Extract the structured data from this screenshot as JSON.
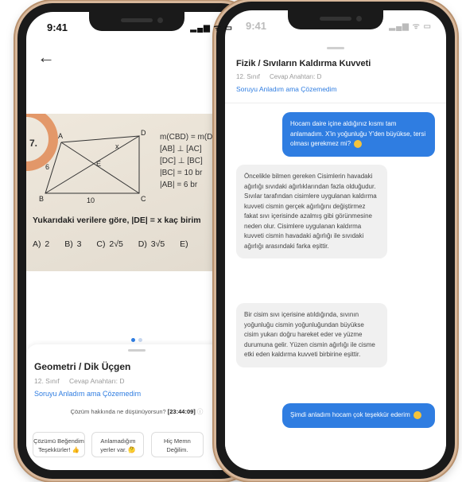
{
  "left_phone": {
    "status_time": "9:41",
    "status_icons": "▂▄▆ ᯤ ▭",
    "question_number": "7.",
    "given": [
      "m(CBD) = m(D",
      "[AB] ⊥ [AC]",
      "[DC] ⊥ [BC]",
      "|BC| = 10 br",
      "|AB| = 6 br"
    ],
    "figure_labels": {
      "A": "A",
      "B": "B",
      "C": "C",
      "D": "D",
      "E": "E",
      "x": "x",
      "six": "6",
      "ten": "10"
    },
    "question_text": "Yukarıdaki verilere göre, |DE| = x kaç birim",
    "choices": [
      "A) 2",
      "B) 3",
      "C) 2√5",
      "D) 3√5",
      "E)"
    ],
    "sheet": {
      "title": "Geometri / Dik Üçgen",
      "grade": "12. Sınıf",
      "answer_key": "Cevap Anahtarı: D",
      "link": "Soruyu Anladım ama Çözemedim",
      "feedback_prompt": "Çözüm hakkında ne düşünüyorsun?",
      "timer": "[23:44:09]",
      "buttons": [
        {
          "l1": "Çözümü Beğendim",
          "l2": "Teşekkürler!"
        },
        {
          "l1": "Anlamadığım",
          "l2": "yerler var."
        },
        {
          "l1": "Hiç Memn",
          "l2": "Değilim."
        }
      ]
    }
  },
  "right_phone": {
    "status_time": "9:41",
    "title": "Fizik / Sıvıların Kaldırma Kuvveti",
    "grade": "12. Sınıf",
    "answer_key": "Cevap Anahtarı: D",
    "link": "Soruyu Anladım ama Çözemedim",
    "messages": [
      {
        "from": "user",
        "text": "Hocam daire içine aldığınız kısmı tam anlamadım. X'in yoğunluğu Y'den büyükse, tersi olması gerekmez mi?"
      },
      {
        "from": "tutor",
        "text": "Öncelikle bilmen gereken Cisimlerin havadaki ağırlığı sıvıdaki ağırlıklarından fazla olduğudur. Sıvılar tarafından cisimlere uygulanan kaldırma kuvveti cismin gerçek ağırlığını değiştirmez fakat sıvı içerisinde azalmış gibi görünmesine neden olur. Cisimlere uygulanan kaldırma kuvveti cismin havadaki ağırlığı ile sıvıdaki ağırlığı arasındaki farka eşittir."
      },
      {
        "from": "tutor",
        "text": "Bir cisim sıvı içerisine atıldığında, sıvının yoğunluğu cismin yoğunluğundan büyükse cisim yukarı doğru hareket eder ve yüzme durumuna gelir. Yüzen cismin ağırlığı ile cisme etki eden kaldırma kuvveti birbirine eşittir."
      },
      {
        "from": "user",
        "text": "Şimdi anladım hocam çok teşekkür ederim"
      }
    ]
  }
}
